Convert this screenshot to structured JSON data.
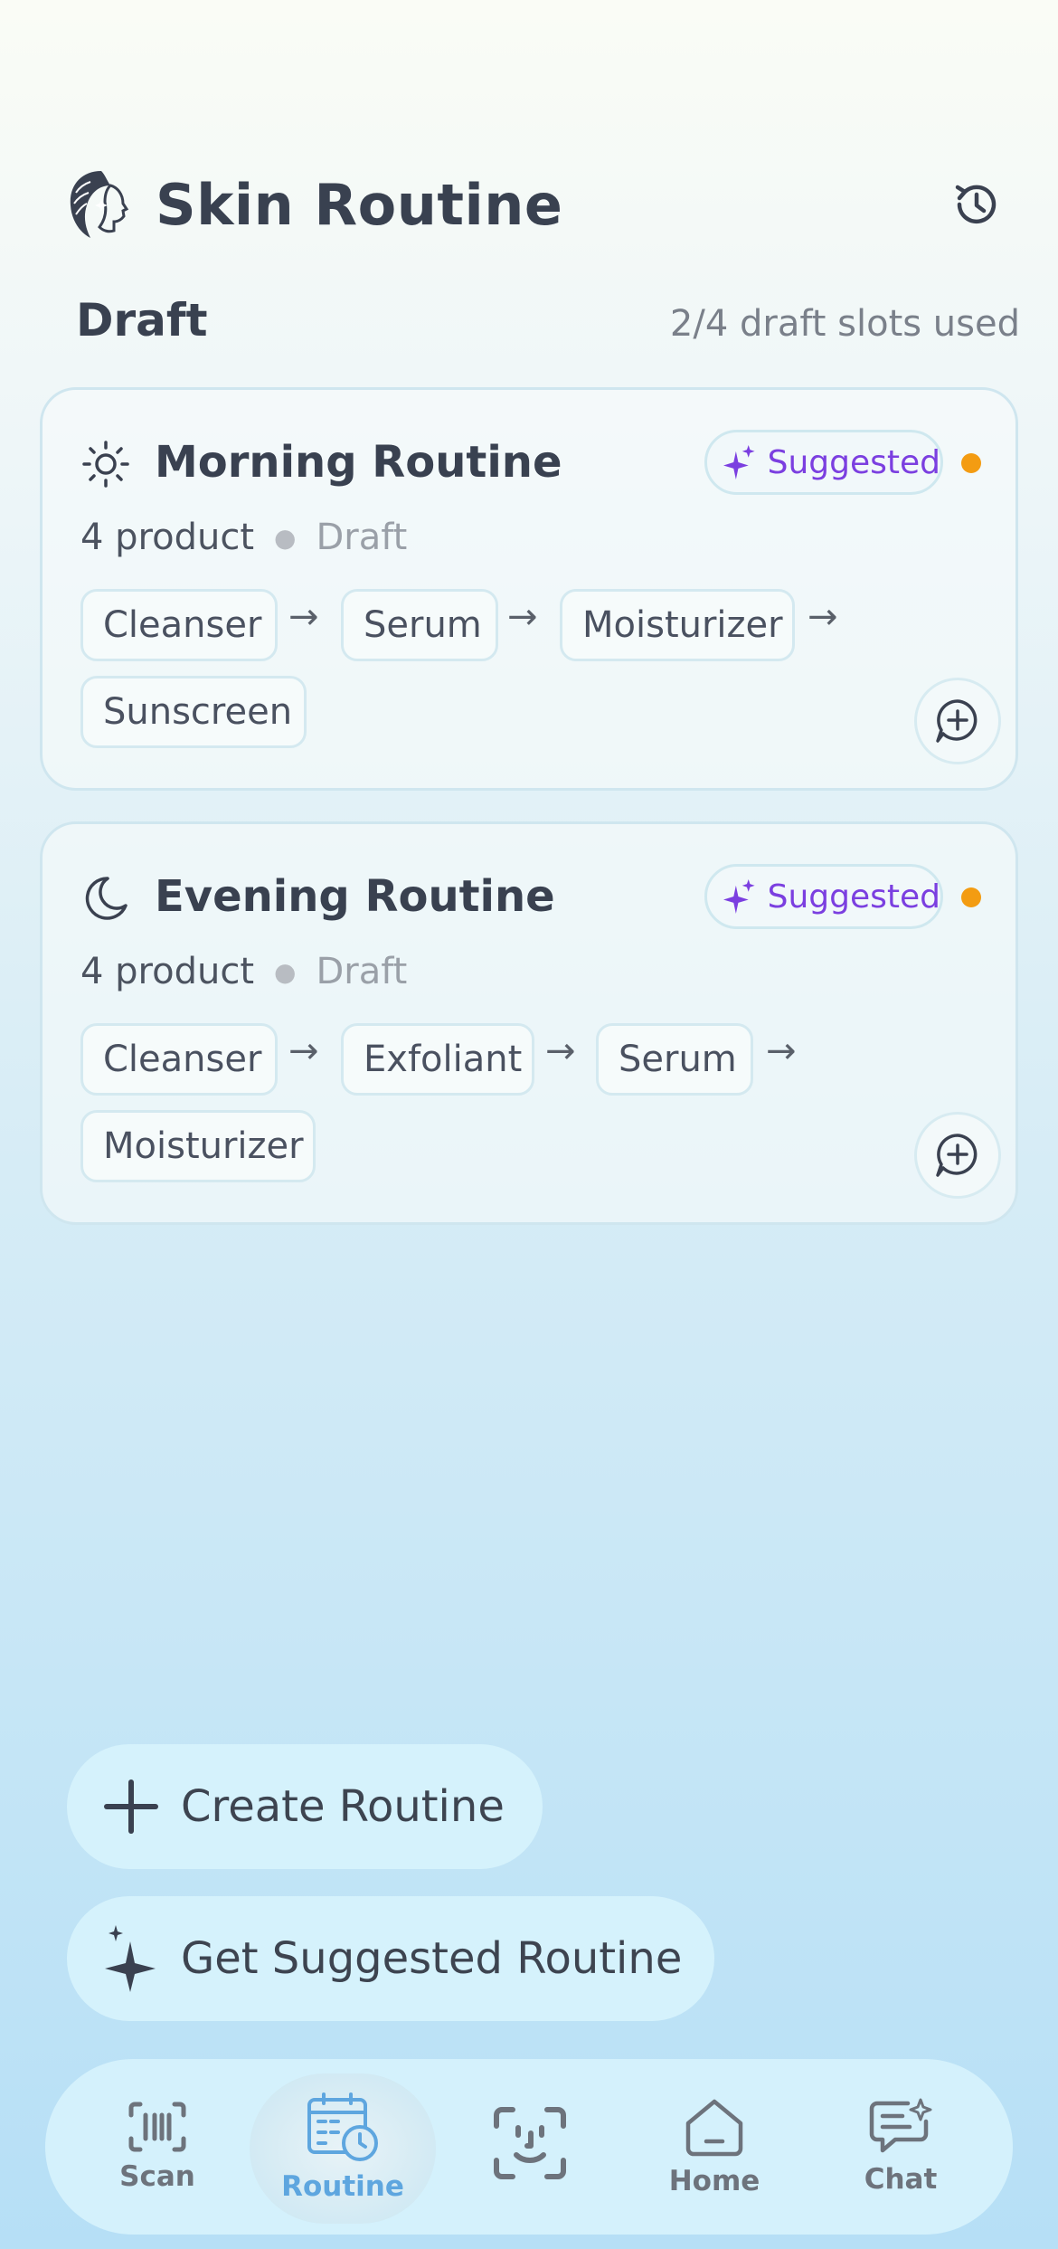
{
  "app": {
    "title": "Skin Routine"
  },
  "section": {
    "title": "Draft",
    "meta": "2/4 draft slots used"
  },
  "cards": [
    {
      "title": "Morning Routine",
      "icon": "sun-icon",
      "badge": "Suggested",
      "count": "4 product",
      "status": "Draft",
      "steps": [
        "Cleanser",
        "Serum",
        "Moisturizer",
        "Sunscreen"
      ],
      "arrow": "→"
    },
    {
      "title": "Evening Routine",
      "icon": "moon-icon",
      "badge": "Suggested",
      "count": "4 product",
      "status": "Draft",
      "steps": [
        "Cleanser",
        "Exfoliant",
        "Serum",
        "Moisturizer"
      ],
      "arrow": "→"
    }
  ],
  "actions": {
    "create": "Create Routine",
    "suggest": "Get Suggested Routine"
  },
  "nav": [
    {
      "label": "Scan",
      "icon": "barcode-scan-icon"
    },
    {
      "label": "Routine",
      "icon": "calendar-clock-icon",
      "active": true
    },
    {
      "label": "",
      "icon": "face-scan-icon"
    },
    {
      "label": "Home",
      "icon": "home-icon"
    },
    {
      "label": "Chat",
      "icon": "chat-sparkle-icon"
    }
  ],
  "colors": {
    "accent": "#5ea6df",
    "suggested": "#7b3fe0",
    "status_dot": "#f39c12",
    "text": "#394150"
  }
}
